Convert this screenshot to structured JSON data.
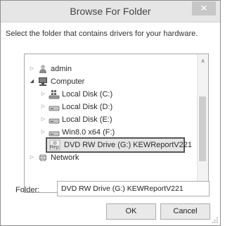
{
  "window": {
    "title": "Browse For Folder",
    "close_glyph": "✕"
  },
  "instruction": "Select the folder that contains drivers for your hardware.",
  "tree": [
    {
      "label": "admin",
      "icon": "user-folder-icon",
      "expander": "▷"
    },
    {
      "label": "Computer",
      "icon": "computer-icon",
      "expander": "◢"
    },
    {
      "label": "Local Disk (C:)",
      "icon": "system-drive-icon",
      "expander": "▷"
    },
    {
      "label": "Local Disk (D:)",
      "icon": "drive-icon",
      "expander": "▷"
    },
    {
      "label": "Local Disk (E:)",
      "icon": "drive-icon",
      "expander": "▷"
    },
    {
      "label": "Win8.0 x64 (F:)",
      "icon": "drive-icon",
      "expander": "▷"
    },
    {
      "label": "DVD RW Drive (G:) KEWReportV221",
      "icon": "dvd-drive-icon",
      "icon_text": "Rep",
      "expander": "",
      "selected": true
    },
    {
      "label": "Network",
      "icon": "network-icon",
      "expander": "▷"
    }
  ],
  "scrollbar": {
    "up": "∧",
    "down": "∨"
  },
  "folder": {
    "label": "Folder:",
    "value": "DVD RW Drive (G:) KEWReportV221"
  },
  "buttons": {
    "ok": "OK",
    "cancel": "Cancel"
  },
  "colors": {
    "titlebar": "#e6e6e6",
    "selection_border": "#555555",
    "selection_fill": "#e5e5e5"
  }
}
